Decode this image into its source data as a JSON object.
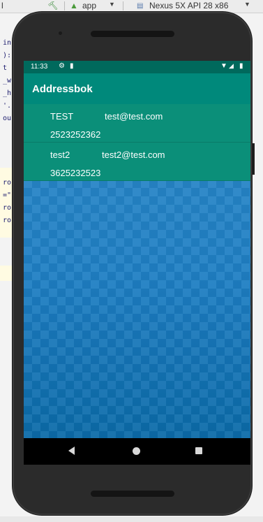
{
  "ide": {
    "toolbar": {
      "run_config": "app",
      "device": "Nexus 5X API 28 x86",
      "left_fragment": "l"
    },
    "code_fragments": [
      "in",
      "):",
      "t",
      "_w",
      "_h",
      "'.",
      "ou",
      "ro",
      "=\"",
      "ro",
      "ro"
    ]
  },
  "device": {
    "status_bar": {
      "time": "11:33",
      "icons": [
        "gear-icon",
        "sd-card-icon",
        "wifi-icon",
        "signal-icon",
        "battery-icon"
      ]
    },
    "app_bar": {
      "title": "Addressbok"
    },
    "contacts": [
      {
        "name": "TEST",
        "email": "test@test.com",
        "phone": "2523252362"
      },
      {
        "name": "test2",
        "email": "test2@test.com",
        "phone": "3625232523"
      }
    ],
    "nav_bar": {
      "icons": [
        "back-icon",
        "home-icon",
        "recents-icon"
      ]
    }
  },
  "colors": {
    "status_bar": "#00695c",
    "app_bar": "#00897b",
    "list_item": "#0b8f79",
    "background": "#1f7fc4"
  }
}
